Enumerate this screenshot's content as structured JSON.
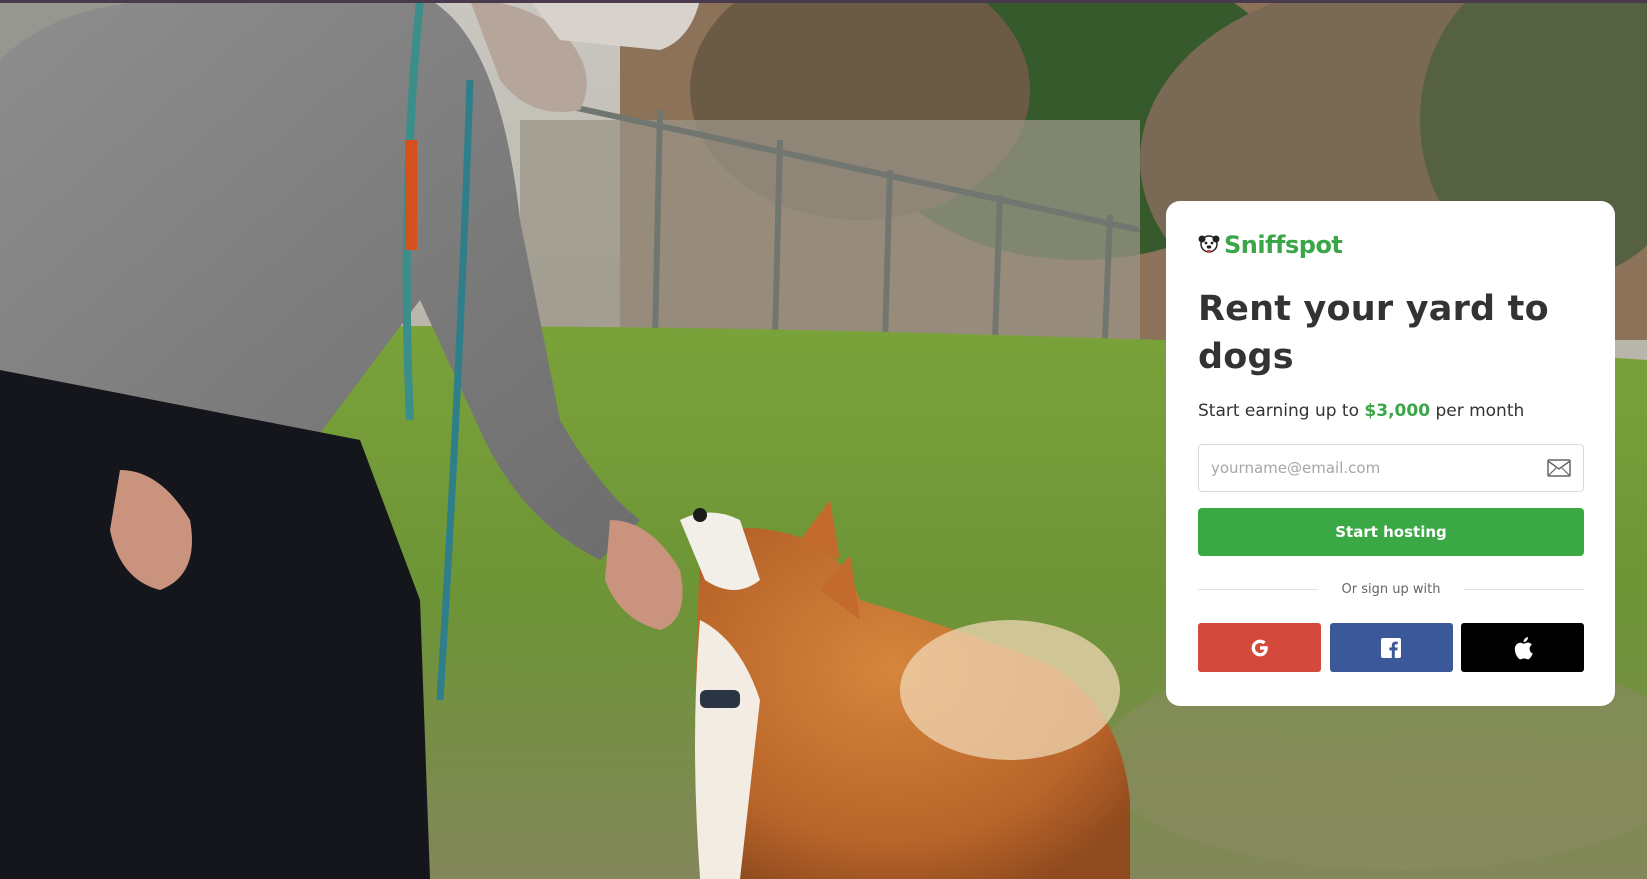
{
  "brand": {
    "name": "Sniffspot",
    "color": "#3aa648"
  },
  "card": {
    "headline": "Rent your yard to dogs",
    "subline_before": "Start earning up to",
    "subline_amount": "$3,000",
    "subline_after": "per month",
    "email_placeholder": "yourname@email.com",
    "email_value": "",
    "start_button_label": "Start hosting",
    "divider_text": "Or sign up with"
  },
  "social": [
    {
      "provider": "google",
      "icon": "google-icon",
      "color": "#d34a3c"
    },
    {
      "provider": "facebook",
      "icon": "facebook-icon",
      "color": "#3b5998"
    },
    {
      "provider": "apple",
      "icon": "apple-icon",
      "color": "#000000"
    }
  ],
  "background": {
    "icon": "hero-photo"
  }
}
